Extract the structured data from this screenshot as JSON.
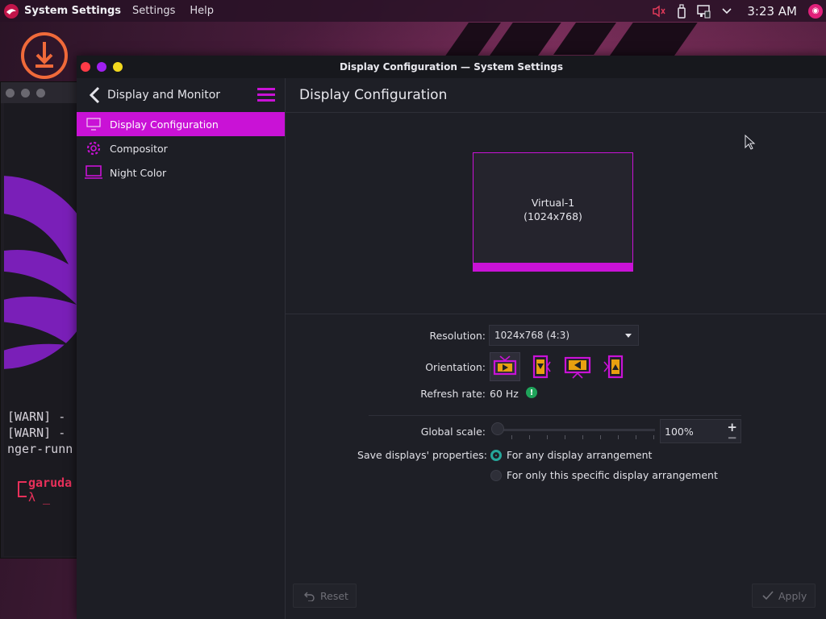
{
  "panel": {
    "app_name": "System Settings",
    "menus": [
      "Settings",
      "Help"
    ],
    "clock": "3:23 AM"
  },
  "terminal": {
    "lines": [
      "[WARN] -",
      "[WARN] -",
      "nger-runn",
      "garuda",
      "λ _"
    ]
  },
  "window": {
    "title": "Display Configuration — System Settings"
  },
  "sidebar": {
    "header": "Display and Monitor",
    "items": [
      {
        "label": "Display Configuration",
        "icon": "display-icon",
        "active": true
      },
      {
        "label": "Compositor",
        "icon": "gear-icon",
        "active": false
      },
      {
        "label": "Night Color",
        "icon": "laptop-icon",
        "active": false
      }
    ]
  },
  "content": {
    "title": "Display Configuration",
    "monitor": {
      "name": "Virtual-1",
      "resolution": "(1024x768)"
    },
    "resolution": {
      "label": "Resolution:",
      "value": "1024x768 (4:3)"
    },
    "orientation": {
      "label": "Orientation:",
      "options": [
        "landscape",
        "portrait",
        "landscape-flipped",
        "portrait-flipped"
      ],
      "selected": "landscape"
    },
    "refresh": {
      "label": "Refresh rate:",
      "value": "60 Hz"
    },
    "global_scale": {
      "label": "Global scale:",
      "value": "100%",
      "slider_fraction": 0.0
    },
    "save_props": {
      "label": "Save displays' properties:",
      "options": [
        {
          "label": "For any display arrangement",
          "checked": true
        },
        {
          "label": "For only this specific display arrangement",
          "checked": false
        }
      ]
    }
  },
  "footer": {
    "reset_label": "Reset",
    "apply_label": "Apply"
  },
  "colors": {
    "accent": "#c912d6",
    "radio_on": "#26a69a",
    "info": "#1fa35a"
  }
}
